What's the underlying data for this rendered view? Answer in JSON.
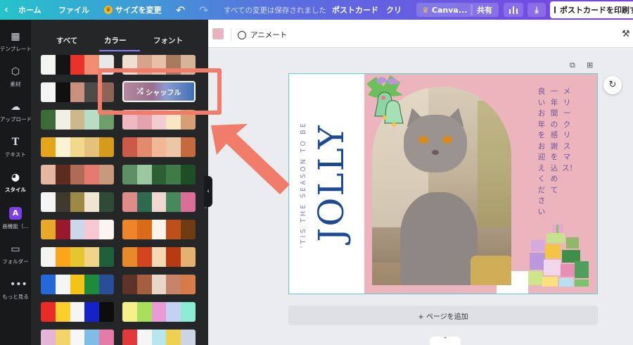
{
  "topbar": {
    "back_icon": "chevron-left-icon",
    "home": "ホーム",
    "file": "ファイル",
    "resize": "サイズを変更",
    "undo_icon": "undo-icon",
    "redo_icon": "redo-icon",
    "saved_status": "すべての変更は保存されました",
    "doc_title": "ポストカード　クリ",
    "pro": "Canva...",
    "share": "共有",
    "stats_icon": "bar-chart-icon",
    "download_icon": "download-icon",
    "print": "ポストカードを印刷す"
  },
  "rail": [
    {
      "label": "テンプレート",
      "icon": "template-icon"
    },
    {
      "label": "素材",
      "icon": "elements-icon"
    },
    {
      "label": "アップロード",
      "icon": "upload-icon"
    },
    {
      "label": "テキスト",
      "icon": "text-icon"
    },
    {
      "label": "スタイル",
      "icon": "style-icon",
      "active": true
    },
    {
      "label": "画機能（...",
      "icon": "apps-icon"
    },
    {
      "label": "フォルダー",
      "icon": "folder-icon"
    },
    {
      "label": "もっと見る",
      "icon": "more-icon"
    }
  ],
  "panel": {
    "tabs": [
      "すべて",
      "カラー",
      "フォント"
    ],
    "active_tab": "カラー",
    "shuffle_label": "シャッフル",
    "palettes_left": [
      [
        "#f5f5f0",
        "#141414",
        "#e8322b",
        "#f28d73",
        "#e8e8e8"
      ],
      [
        "#f4f4f4",
        "#0f0f0f",
        "#c9917d",
        "#4e4a47",
        "#8c6458"
      ],
      [
        "#3c6b3a",
        "#f1efe6",
        "#cbb98c",
        "#b9dcc4",
        "#6f9e6a"
      ],
      [
        "#e3a51c",
        "#fbf3d6",
        "#f0d98a",
        "#e5c27b",
        "#d79b1c"
      ],
      [
        "#e5b7a3",
        "#5c2c22",
        "#b06a55",
        "#e47a6f",
        "#c79a7d"
      ],
      [
        "#f5f5f5",
        "#3f3a2d",
        "#9c8a44",
        "#f0e6cf",
        "#2f4a37"
      ],
      [
        "#e8a82a",
        "#98182e",
        "#cbd8eb",
        "#f7c8d2",
        "#faf5f0"
      ],
      [
        "#f4f4f0",
        "#fca41a",
        "#e6c62e",
        "#f2d38a",
        "#1f5f3c"
      ],
      [
        "#2569d8",
        "#f5f5f5",
        "#f3c417",
        "#1b8b3b",
        "#284e9a"
      ],
      [
        "#ec2b26",
        "#fbd02d",
        "#f5f5f5",
        "#1622c9",
        "#0d0d0d"
      ],
      [
        "#e5b5d8",
        "#f5d36b",
        "#f7f7f7",
        "#7fbde8",
        "#e67aa9"
      ]
    ],
    "palettes_right": [
      [
        "#eedfd0",
        "#d5a48a",
        "#e6c0a8",
        "#a77a5d",
        "#d6b49b"
      ],
      [
        "#efbac3",
        "#e8b7c7",
        "#a58acb",
        "#f2b0b8",
        "#355f9c"
      ],
      [
        "#f0b8c2",
        "#e3a2ac",
        "#f2ccd1",
        "#f7e6c4",
        "#d79f76"
      ],
      [
        "#cc5a48",
        "#e28a6c",
        "#f1b797",
        "#ebc7a8",
        "#c46a3e"
      ],
      [
        "#5f8f65",
        "#9dc7a1",
        "#2d5e34",
        "#3f7b47",
        "#1e4d28"
      ],
      [
        "#e08a8a",
        "#2e6a4f",
        "#f0d8d0",
        "#468a5b",
        "#db6e97"
      ],
      [
        "#f0842a",
        "#d96a1a",
        "#faf3e7",
        "#bf4f1a",
        "#6f3b13"
      ],
      [
        "#e98a2a",
        "#d4451d",
        "#f6d8b3",
        "#b73a12",
        "#e5b173"
      ],
      [
        "#5e3328",
        "#a45f3e",
        "#e9d6c6",
        "#c8846a",
        "#d87b4a"
      ],
      [
        "#f6f08a",
        "#a8e05d",
        "#ea9ad4",
        "#c4d0f4",
        "#8bebd3"
      ],
      [
        "#e23a3a",
        "#f5f5f5",
        "#b8e6ef",
        "#f0d050",
        "#ccd5e6"
      ]
    ]
  },
  "editor": {
    "color_swatch": "#eeb1bd",
    "animate_label": "アニメート",
    "paint_icon": "paint-roller-icon"
  },
  "card": {
    "jolly": "JOLLY",
    "season": "'TIS THE SEASON TO BE",
    "jp_columns": [
      "メリークリスマス！",
      "一年間の感謝を込めて",
      "良いお年をお迎えください"
    ],
    "accent_pink": "#ecb4bd",
    "accent_blue": "#1d4a93",
    "accent_purple": "#8f7dc0"
  },
  "canvas": {
    "add_page": "+ ページを追加",
    "copy_icon": "duplicate-page-icon",
    "add_icon": "add-page-icon",
    "refresh_icon": "magic-refresh-icon",
    "scroll_icon": "chevron-up-icon"
  },
  "annotation": {
    "color": "#f27c6a"
  }
}
